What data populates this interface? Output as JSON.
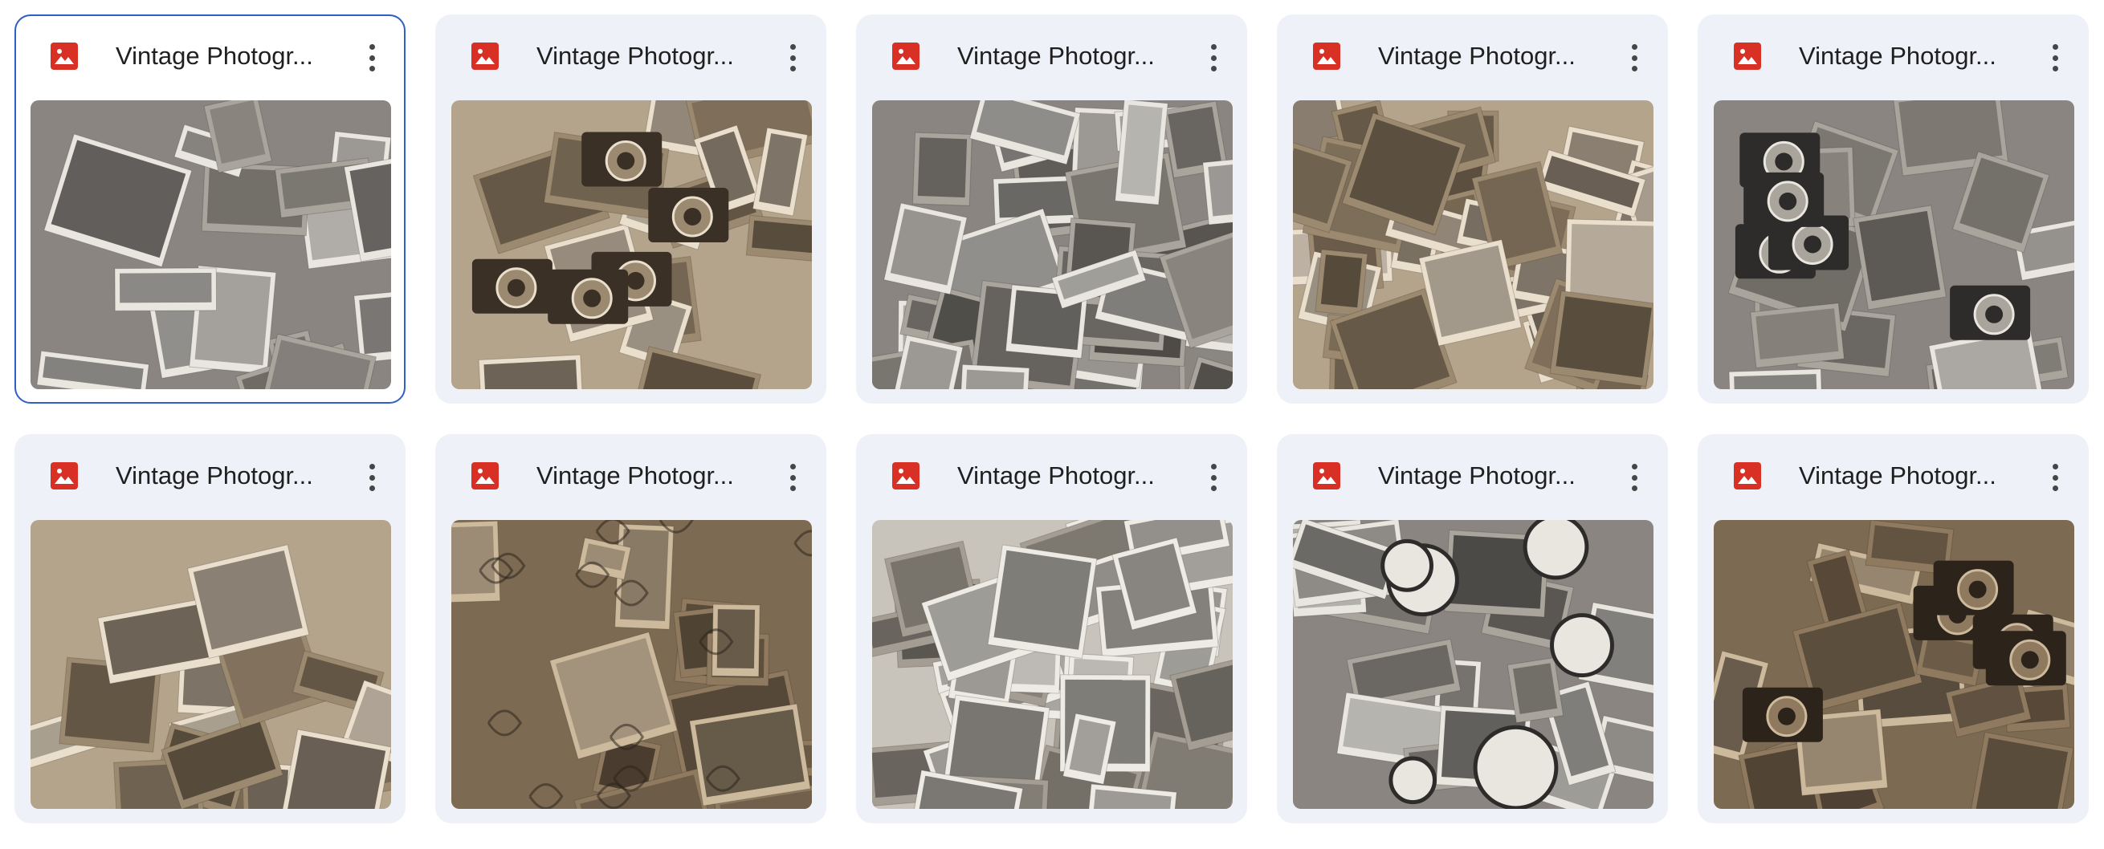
{
  "files": [
    {
      "title": "Vintage Photogr...",
      "selected": true,
      "theme": "photos-pile",
      "tone": "gray"
    },
    {
      "title": "Vintage Photogr...",
      "selected": false,
      "theme": "cameras",
      "tone": "sepia"
    },
    {
      "title": "Vintage Photogr...",
      "selected": false,
      "theme": "collage",
      "tone": "gray"
    },
    {
      "title": "Vintage Photogr...",
      "selected": false,
      "theme": "collage",
      "tone": "sepia"
    },
    {
      "title": "Vintage Photogr...",
      "selected": false,
      "theme": "camera-city",
      "tone": "gray"
    },
    {
      "title": "Vintage Photogr...",
      "selected": false,
      "theme": "photos-pile",
      "tone": "sepia"
    },
    {
      "title": "Vintage Photogr...",
      "selected": false,
      "theme": "floral",
      "tone": "sepia-dark"
    },
    {
      "title": "Vintage Photogr...",
      "selected": false,
      "theme": "collage-light",
      "tone": "gray-light"
    },
    {
      "title": "Vintage Photogr...",
      "selected": false,
      "theme": "clocks",
      "tone": "gray"
    },
    {
      "title": "Vintage Photogr...",
      "selected": false,
      "theme": "cameras",
      "tone": "sepia-dark"
    }
  ],
  "icons": {
    "file_type": "image-file-icon",
    "more": "more-vert-icon"
  },
  "colors": {
    "image_icon": "#d93025",
    "card_bg": "#eef1f8",
    "selected_border": "#2d5fc7"
  }
}
